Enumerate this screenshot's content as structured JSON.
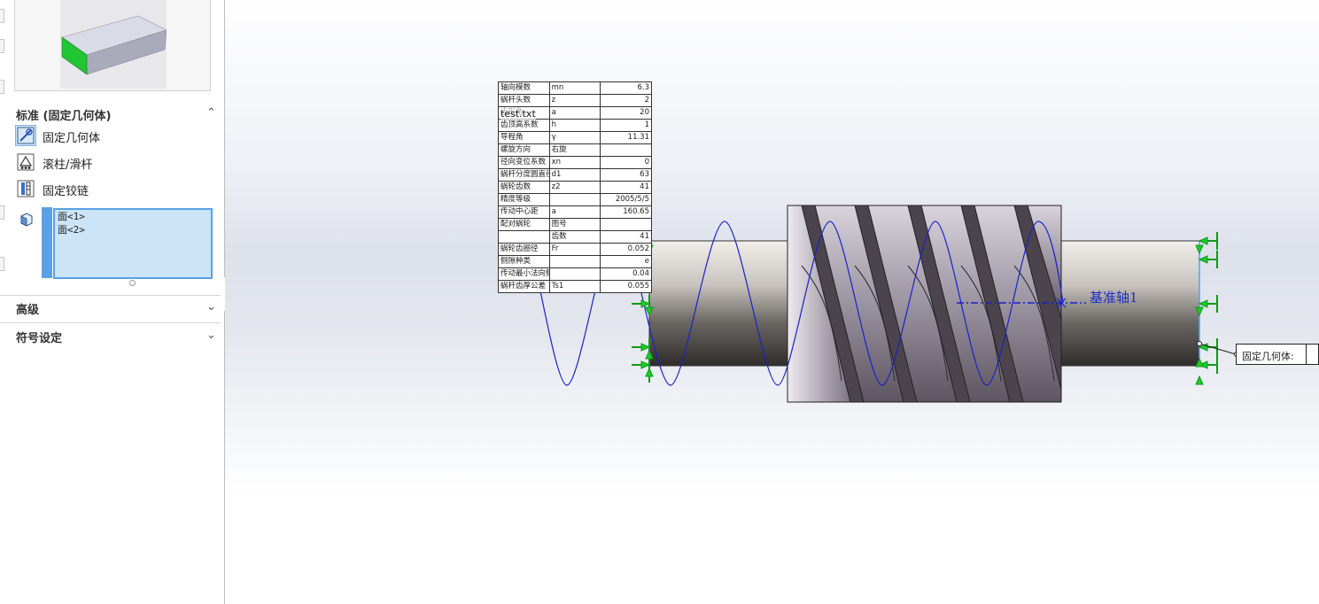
{
  "property_manager": {
    "standard_section": {
      "title": "标准 (固定几何体)",
      "options": [
        {
          "label": "固定几何体",
          "icon": "fixed-geometry-icon",
          "selected": true
        },
        {
          "label": "滚柱/滑杆",
          "icon": "roller-slider-icon",
          "selected": false
        },
        {
          "label": "固定铰链",
          "icon": "fixed-hinge-icon",
          "selected": false
        }
      ],
      "selection_list": [
        "面<1>",
        "面<2>"
      ]
    },
    "advanced_section": {
      "title": "高级"
    },
    "symbol_section": {
      "title": "符号设定"
    }
  },
  "spec_table": {
    "rows": [
      [
        "轴向模数",
        "mn",
        "6.3"
      ],
      [
        "蜗杆头数",
        "z",
        "2"
      ],
      [
        "齿形角",
        "a",
        "20"
      ],
      [
        "齿顶高系数",
        "h",
        "1"
      ],
      [
        "导程角",
        "γ",
        "11.31"
      ],
      [
        "螺旋方向",
        "右旋",
        ""
      ],
      [
        "径向变位系数",
        "xn",
        "0"
      ],
      [
        "蜗杆分度圆直径",
        "d1",
        "63"
      ],
      [
        "蜗轮齿数",
        "z2",
        "41"
      ],
      [
        "精度等级",
        "",
        "2005/5/5"
      ],
      [
        "传动中心距",
        "a",
        "160.65"
      ],
      [
        "配对蜗轮",
        "图号",
        ""
      ],
      [
        "",
        "齿数",
        "41"
      ],
      [
        "蜗轮齿圈径",
        "Fr",
        "0.052"
      ],
      [
        "侧隙种类",
        "",
        "e"
      ],
      [
        "传动最小法向侧隙jnmin",
        "",
        "0.04"
      ],
      [
        "蜗杆齿厚公差",
        "Ts1",
        "0.055"
      ]
    ],
    "overlay_label": "test.txt"
  },
  "viewport": {
    "axis_label": "基准轴1",
    "fixture_callout": "固定几何体:"
  },
  "colors": {
    "accent_blue": "#5aa0e6",
    "fixture_green": "#1ccc2a",
    "helix_blue": "#1a22c8"
  }
}
